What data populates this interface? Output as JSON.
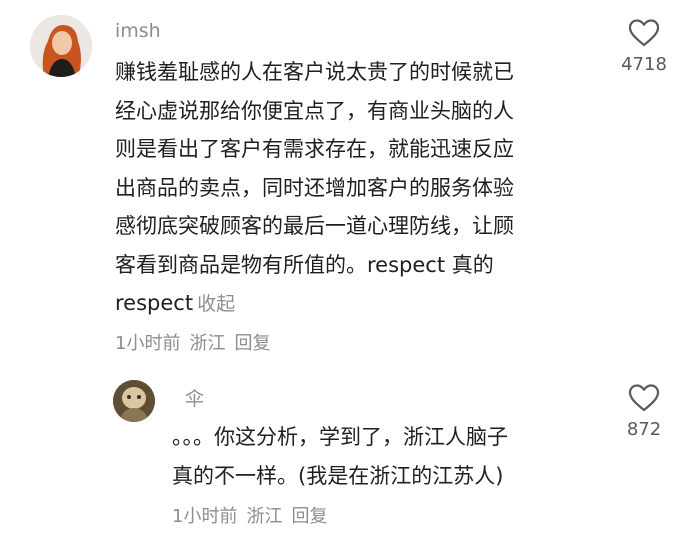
{
  "comments": [
    {
      "username": "imsh",
      "text_lines": [
        "赚钱羞耻感的人在客户说太贵了的时候就已",
        "经心虚说那给你便宜点了，有商业头脑的人",
        "则是看出了客户有需求存在，就能迅速反应",
        "出商品的卖点，同时还增加客户的服务体验",
        "感彻底突破顾客的最后一道心理防线，让顾",
        "客看到商品是物有所值的。respect 真的",
        "respect"
      ],
      "collapse_label": "收起",
      "time": "1小时前",
      "location": "浙江",
      "reply_label": "回复",
      "like_count": "4718",
      "like_icon": "heart-outline-icon"
    },
    {
      "username": "伞",
      "text_lines": [
        "。。。你这分析，学到了，浙江人脑子",
        "真的不一样。(我是在浙江的江苏人)"
      ],
      "time": "1小时前",
      "location": "浙江",
      "reply_label": "回复",
      "like_count": "872",
      "like_icon": "heart-outline-icon"
    }
  ],
  "colors": {
    "text": "#1f1f1f",
    "muted": "#8d8d8d",
    "like_count": "#5a5a5a"
  }
}
